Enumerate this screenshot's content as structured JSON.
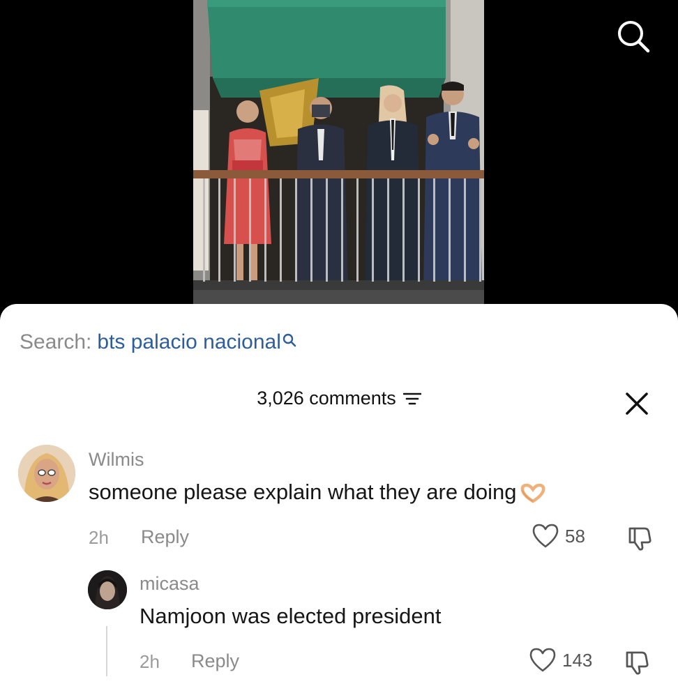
{
  "header": {
    "search_icon": "search-icon"
  },
  "search": {
    "label": "Search:",
    "term": "bts palacio nacional",
    "icon": "search-mini-icon"
  },
  "comments_header": {
    "count_label": "3,026 comments",
    "filter_icon": "filter-icon",
    "close_icon": "close-icon"
  },
  "comments": [
    {
      "user": "Wilmis",
      "text": "someone please explain what they are doing",
      "emoji": "heart-hands-emoji",
      "time": "2h",
      "reply_label": "Reply",
      "likes": "58"
    },
    {
      "user": "micasa",
      "text": "Namjoon was elected president",
      "time": "2h",
      "reply_label": "Reply",
      "likes": "143"
    }
  ],
  "colors": {
    "link_blue": "#2e5e9a",
    "muted_gray": "#8a8a8a",
    "awning_green": "#2f8a6e"
  }
}
